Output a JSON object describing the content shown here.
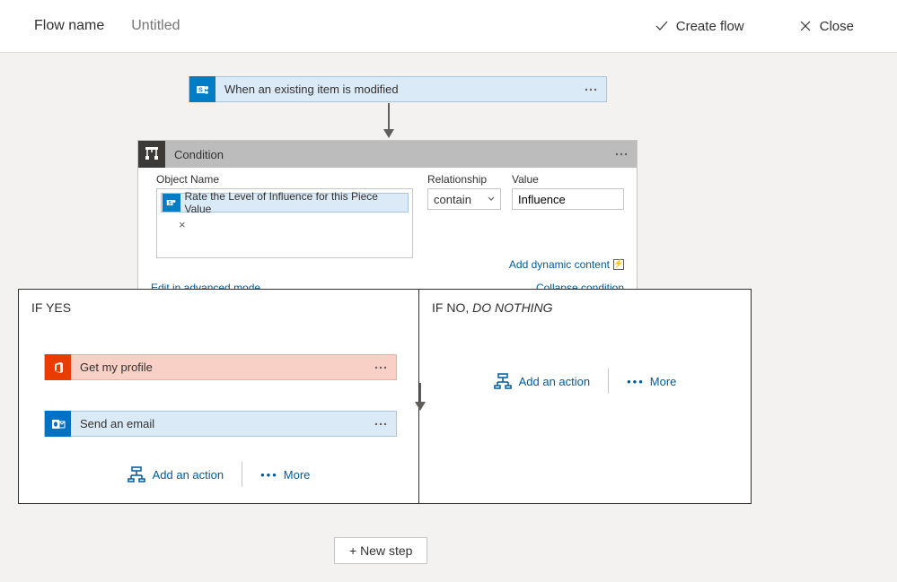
{
  "header": {
    "flow_name_label": "Flow name",
    "flow_name_value": "Untitled",
    "create_flow": "Create flow",
    "close": "Close"
  },
  "trigger": {
    "title": "When an existing item is modified"
  },
  "condition": {
    "title": "Condition",
    "object_name_label": "Object Name",
    "token_text": "Rate the Level of Influence for this Piece Value",
    "relationship_label": "Relationship",
    "relationship_value": "contain",
    "value_label": "Value",
    "value_value": "Influence",
    "add_dynamic_content": "Add dynamic content",
    "edit_advanced": "Edit in advanced mode",
    "collapse": "Collapse condition"
  },
  "branches": {
    "yes_label": "IF YES",
    "no_label_prefix": "IF NO, ",
    "no_label_italic": "DO NOTHING",
    "add_action": "Add an action",
    "more": "More"
  },
  "actions": {
    "get_profile": "Get my profile",
    "send_email": "Send an email"
  },
  "footer": {
    "new_step": "+ New step"
  },
  "icons": {
    "sharepoint": "sharepoint-icon",
    "condition": "condition-icon",
    "office": "office-icon",
    "outlook": "outlook-icon",
    "add_action": "add-action-icon"
  }
}
